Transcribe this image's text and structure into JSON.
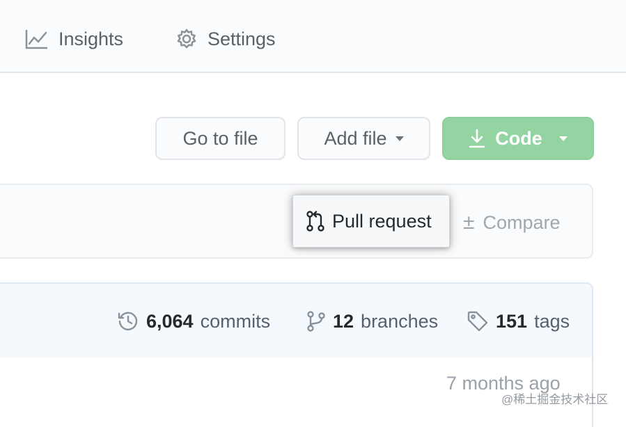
{
  "nav": {
    "insights": "Insights",
    "settings": "Settings"
  },
  "actions": {
    "go_to_file": "Go to file",
    "add_file": "Add file",
    "code": "Code"
  },
  "branch_bar": {
    "pull_request": "Pull request",
    "compare": "Compare"
  },
  "summary": {
    "commits_count": "6,064",
    "commits_label": "commits",
    "branches_count": "12",
    "branches_label": "branches",
    "tags_count": "151",
    "tags_label": "tags"
  },
  "latest": {
    "age": "7 months ago"
  },
  "watermark": "@稀土掘金技术社区",
  "icons": {
    "insights": "graph-icon",
    "settings": "gear-icon",
    "code": "download-icon",
    "pull_request": "git-pull-request-icon",
    "compare": "diff-icon",
    "commits": "history-icon",
    "branches": "git-branch-icon",
    "tags": "tag-icon"
  },
  "colors": {
    "code_button": "#94d3a2",
    "nav_text": "#586069",
    "summary_bg": "#f4f9fe"
  }
}
